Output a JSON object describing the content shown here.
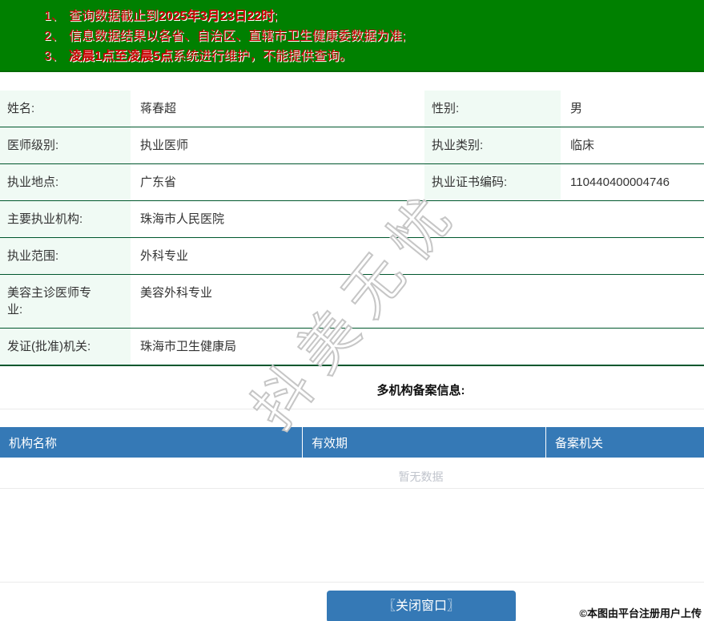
{
  "notices": {
    "items": [
      {
        "num": "1、",
        "pre": "查询数据截止到",
        "bold": "2025年3月23日22时",
        "post": ";"
      },
      {
        "num": "2、",
        "pre": "信息数据结果以各省、自治区、直辖市卫生健康委数据为准;",
        "bold": "",
        "post": ""
      },
      {
        "num": "3、",
        "pre": "",
        "bold": "凌晨1点至凌晨5点",
        "post": "系统进行维护，不能提供查询。"
      }
    ]
  },
  "info": {
    "rows": [
      {
        "l1": "姓名:",
        "v1": "蒋春超",
        "l2": "性别:",
        "v2": "男"
      },
      {
        "l1": "医师级别:",
        "v1": "执业医师",
        "l2": "执业类别:",
        "v2": "临床"
      },
      {
        "l1": "执业地点:",
        "v1": "广东省",
        "l2": "执业证书编码:",
        "v2": "110440400004746"
      },
      {
        "l1": "主要执业机构:",
        "v1": "珠海市人民医院"
      },
      {
        "l1": "执业范围:",
        "v1": "外科专业"
      },
      {
        "l1": "美容主诊医师专\n业:",
        "v1": "美容外科专业"
      },
      {
        "l1": "发证(批准)机关:",
        "v1": "珠海市卫生健康局"
      }
    ]
  },
  "filing": {
    "title": "多机构备案信息:",
    "columns": [
      "机构名称",
      "有效期",
      "备案机关"
    ],
    "empty_text": "暂无数据"
  },
  "watermark": {
    "text": "抖美无忧"
  },
  "footer": {
    "close_button": "〖关闭窗口〗",
    "attribution": "©本图由平台注册用户上传"
  },
  "colors": {
    "banner_green": "#008000",
    "notice_red": "#c80000",
    "table_border_green": "#00572d",
    "label_bg_mint": "#f0faf4",
    "accent_blue": "#3579b6",
    "empty_gray": "#c0c4cc"
  }
}
